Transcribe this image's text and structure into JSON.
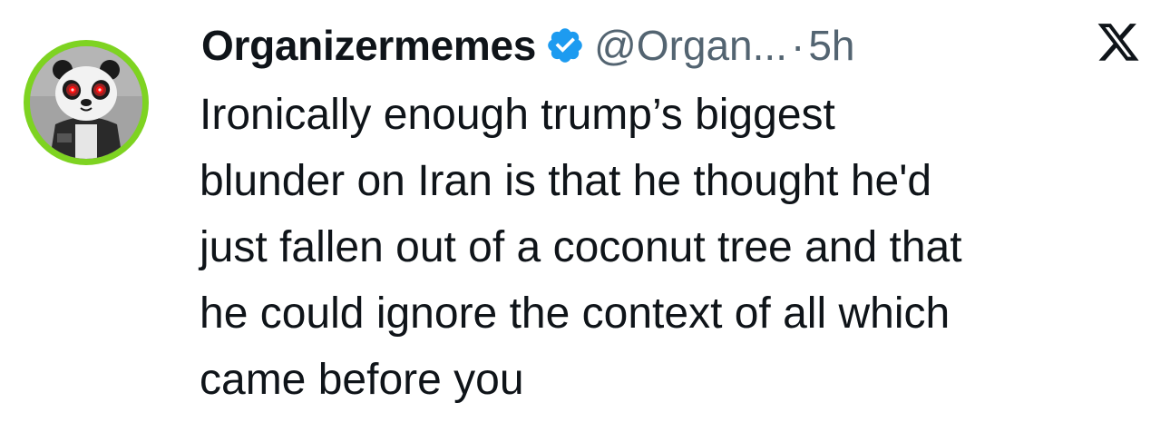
{
  "author": {
    "display_name": "Organizermemes",
    "handle": "@Organ...",
    "separator": "·",
    "timestamp": "5h",
    "verified_badge_icon": "verified-badge-icon",
    "avatar_description": "panda mascot with glowing red eyes",
    "avatar_ring_color": "#7ed321"
  },
  "tweet": {
    "lines": [
      "Ironically enough trump’s biggest",
      "blunder on Iran is that he thought he'd",
      "just fallen out of a coconut tree and that",
      "he could ignore the context of all which",
      "came before you"
    ]
  },
  "platform": {
    "logo_icon": "x-logo-icon"
  },
  "colors": {
    "text_primary": "#0f1419",
    "text_secondary": "#536471",
    "verified_blue": "#1d9bf0",
    "background": "#ffffff"
  }
}
